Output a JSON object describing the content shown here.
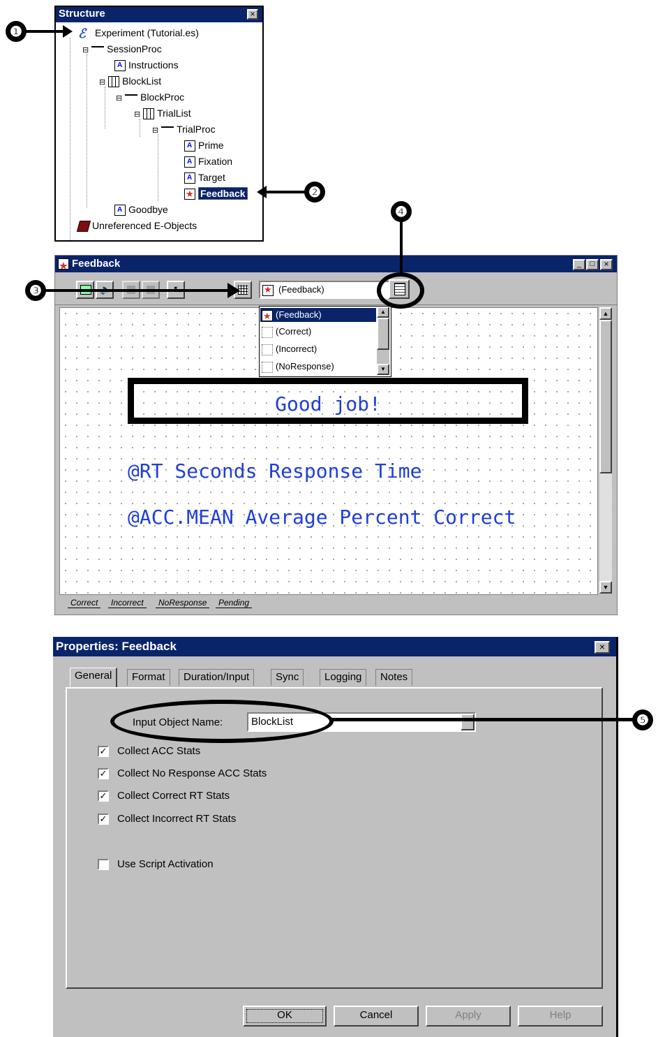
{
  "structure": {
    "title": "Structure",
    "close": "×",
    "items": [
      {
        "label": "Experiment (Tutorial.es)"
      },
      {
        "label": "SessionProc"
      },
      {
        "label": "Instructions"
      },
      {
        "label": "BlockList"
      },
      {
        "label": "BlockProc"
      },
      {
        "label": "TrialList"
      },
      {
        "label": "TrialProc"
      },
      {
        "label": "Prime"
      },
      {
        "label": "Fixation"
      },
      {
        "label": "Target"
      },
      {
        "label": "Feedback"
      },
      {
        "label": "Goodbye"
      },
      {
        "label": "Unreferenced E-Objects"
      }
    ]
  },
  "markers": [
    "❶",
    "❷",
    "❸",
    "❹",
    "❺"
  ],
  "feedback_window": {
    "title": "Feedback",
    "controls": [
      "_",
      "□",
      "×"
    ],
    "selected_state": "(Feedback)",
    "dropdown_options": [
      "(Feedback)",
      "(Correct)",
      "(Incorrect)",
      "(NoResponse)"
    ],
    "canvas_text": {
      "box": "Good job!",
      "line1": "@RT Seconds Response Time",
      "line2": "@ACC.MEAN Average Percent Correct"
    },
    "bottom_tabs": [
      "Correct",
      "Incorrect",
      "NoResponse",
      "Pending"
    ]
  },
  "properties": {
    "title": "Properties: Feedback",
    "close": "×",
    "tabs": [
      "General",
      "Format",
      "Duration/Input",
      "Sync",
      "Logging",
      "Notes"
    ],
    "input_object_label": "Input Object Name:",
    "input_object_value": "BlockList",
    "checkboxes": [
      {
        "label": "Collect ACC Stats",
        "checked": true
      },
      {
        "label": "Collect No Response ACC Stats",
        "checked": true
      },
      {
        "label": "Collect Correct RT Stats",
        "checked": true
      },
      {
        "label": "Collect Incorrect RT Stats",
        "checked": true
      },
      {
        "label": "Use Script Activation",
        "checked": false
      }
    ],
    "check_mark": "✓",
    "buttons": {
      "ok": "OK",
      "cancel": "Cancel",
      "apply": "Apply",
      "help": "Help"
    }
  }
}
